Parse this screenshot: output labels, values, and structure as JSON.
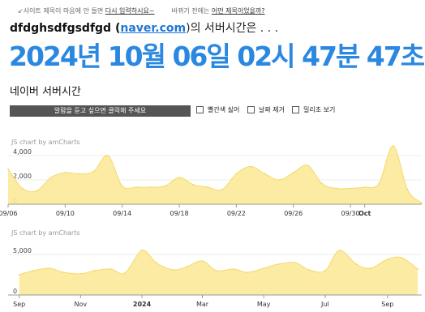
{
  "notice": {
    "prefix": "↙사이트 제목이 마음에 안 들면",
    "link1": "다시 입력하시요~",
    "middle": "바뀌기 전에는",
    "link2": "어떤 제목이었을까?"
  },
  "header": {
    "title_prefix": "dfdghsdfgsdfgd (",
    "site": "naver.com",
    "title_suffix": ")의 서버시간은 . . ."
  },
  "clock": {
    "display": "2024년 10월 06일 02시 47분 47초"
  },
  "subtitle": "네이버 서버시간",
  "controls": {
    "alarm_button": "알람을 듣고 싶으면 클릭해 주세요",
    "options": [
      "빨간색 싫어",
      "날짜 제거",
      "밀리초 보기"
    ]
  },
  "chart_data": [
    {
      "type": "area",
      "credit": "JS chart by amCharts",
      "ylim": [
        0,
        5000
      ],
      "yticks": [
        "0",
        "2,000",
        "4,000"
      ],
      "ytick_values": [
        0,
        2000,
        4000
      ],
      "xlim": [
        "2024-09-06",
        "2024-10-05"
      ],
      "xtick_labels": [
        "09/06",
        "09/10",
        "09/14",
        "09/18",
        "09/22",
        "09/26",
        "09/30",
        "Oct"
      ],
      "xtick_dates": [
        "2024-09-06",
        "2024-09-10",
        "2024-09-14",
        "2024-09-18",
        "2024-09-22",
        "2024-09-26",
        "2024-09-30",
        "2024-10-01"
      ],
      "bold_ticks": [
        "Oct"
      ],
      "color": "#fce999",
      "x": [
        "2024-09-06",
        "2024-09-07",
        "2024-09-08",
        "2024-09-09",
        "2024-09-10",
        "2024-09-11",
        "2024-09-12",
        "2024-09-13",
        "2024-09-14",
        "2024-09-15",
        "2024-09-16",
        "2024-09-17",
        "2024-09-18",
        "2024-09-19",
        "2024-09-20",
        "2024-09-21",
        "2024-09-22",
        "2024-09-23",
        "2024-09-24",
        "2024-09-25",
        "2024-09-26",
        "2024-09-27",
        "2024-09-28",
        "2024-09-29",
        "2024-09-30",
        "2024-10-01",
        "2024-10-02",
        "2024-10-03",
        "2024-10-04",
        "2024-10-05"
      ],
      "values": [
        2900,
        1300,
        1100,
        2200,
        2600,
        2500,
        2700,
        4000,
        1500,
        1400,
        1400,
        1500,
        2200,
        1600,
        1400,
        1200,
        2500,
        3100,
        2500,
        2000,
        2600,
        3200,
        1700,
        1300,
        1300,
        1400,
        1700,
        4800,
        1200,
        100
      ]
    },
    {
      "type": "area",
      "credit": "JS chart by amCharts",
      "ylim": [
        0,
        7500
      ],
      "yticks": [
        "0",
        "5,000"
      ],
      "ytick_values": [
        0,
        5000
      ],
      "xlim": [
        "2023-08-21",
        "2024-10-05"
      ],
      "xtick_labels": [
        "Sep",
        "Nov",
        "2024",
        "Mar",
        "May",
        "Jul",
        "Sep"
      ],
      "xtick_dates": [
        "2023-09-01",
        "2023-11-01",
        "2024-01-01",
        "2024-03-01",
        "2024-05-01",
        "2024-07-01",
        "2024-09-01"
      ],
      "bold_ticks": [
        "2024"
      ],
      "color": "#fce999",
      "x": [
        "2023-09-01",
        "2023-09-15",
        "2023-10-01",
        "2023-10-15",
        "2023-11-01",
        "2023-11-15",
        "2023-12-01",
        "2023-12-15",
        "2024-01-01",
        "2024-01-15",
        "2024-02-01",
        "2024-02-15",
        "2024-03-01",
        "2024-03-15",
        "2024-04-01",
        "2024-04-15",
        "2024-05-01",
        "2024-05-15",
        "2024-06-01",
        "2024-06-15",
        "2024-07-01",
        "2024-07-15",
        "2024-08-01",
        "2024-08-15",
        "2024-09-01",
        "2024-09-15",
        "2024-10-01"
      ],
      "values": [
        2500,
        3000,
        3300,
        2800,
        2600,
        3000,
        3200,
        2700,
        5500,
        4000,
        3100,
        3500,
        4200,
        3000,
        3200,
        2800,
        3300,
        3800,
        4000,
        3100,
        3000,
        5500,
        3800,
        3300,
        4400,
        4600,
        3200
      ]
    }
  ]
}
